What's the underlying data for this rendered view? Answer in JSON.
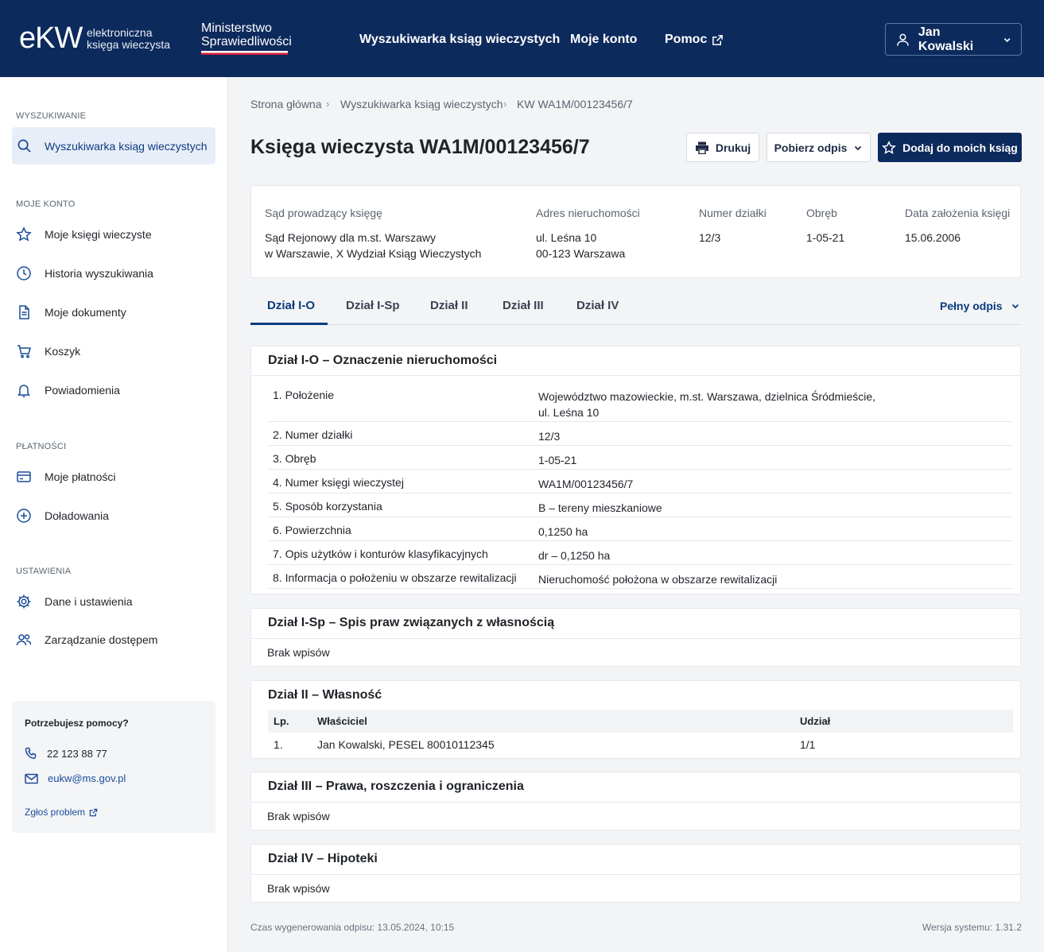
{
  "header": {
    "logo_main": "eKW",
    "logo_sub_1": "elektroniczna",
    "logo_sub_2": "księga wieczysta",
    "ministry_1": "Ministerstwo",
    "ministry_2": "Sprawiedliwości",
    "nav": [
      "Wyszukiwarka ksiąg wieczystych",
      "Moje konto",
      "Pomoc"
    ],
    "user": "Jan Kowalski"
  },
  "sidebar": {
    "sections": {
      "search": "WYSZUKIWANIE",
      "account": "MOJE KONTO",
      "payments": "PŁATNOŚCI",
      "settings": "USTAWIENIA"
    },
    "items": [
      {
        "label": "Wyszukiwarka ksiąg wieczystych",
        "icon": "search-icon"
      },
      {
        "label": "Moje księgi wieczyste",
        "icon": "star-icon"
      },
      {
        "label": "Historia wyszukiwania",
        "icon": "clock-icon"
      },
      {
        "label": "Moje dokumenty",
        "icon": "document-icon"
      },
      {
        "label": "Koszyk",
        "icon": "cart-icon"
      },
      {
        "label": "Powiadomienia",
        "icon": "bell-icon"
      },
      {
        "label": "Moje płatności",
        "icon": "card-icon"
      },
      {
        "label": "Doładowania",
        "icon": "plus-circle-icon"
      },
      {
        "label": "Dane i ustawienia",
        "icon": "gear-icon"
      },
      {
        "label": "Zarządzanie dostępem",
        "icon": "users-icon"
      }
    ],
    "help": {
      "title": "Potrzebujesz pomocy?",
      "phone": "22 123 88 77",
      "email": "eukw@ms.gov.pl",
      "report": "Zgłoś problem"
    }
  },
  "breadcrumb": [
    "Strona główna",
    "Wyszukiwarka ksiąg wieczystych",
    "KW WA1M/00123456/7"
  ],
  "title": "Księga wieczysta WA1M/00123456/7",
  "actions": {
    "print": "Drukuj",
    "download": "Pobierz odpis",
    "add": "Dodaj do moich ksiąg"
  },
  "info": {
    "court_label": "Sąd prowadzący księgę",
    "court_1": "Sąd Rejonowy dla m.st. Warszawy",
    "court_2": "w Warszawie, X Wydział Ksiąg Wieczystych",
    "address_label": "Adres nieruchomości",
    "address_1": "ul. Leśna 10",
    "address_2": "00-123 Warszawa",
    "plot_label": "Numer działki",
    "plot": "12/3",
    "precinct_label": "Obręb",
    "precinct": "1-05-21",
    "date_label": "Data założenia księgi",
    "date": "15.06.2006"
  },
  "tabs": [
    "Dział I-O",
    "Dział I-Sp",
    "Dział II",
    "Dział III",
    "Dział IV"
  ],
  "full_copy": "Pełny odpis",
  "section_io": {
    "title": "Dział I-O – Oznaczenie nieruchomości",
    "rows": [
      {
        "k": "1. Położenie",
        "v": "Województwo mazowieckie, m.st. Warszawa, dzielnica Śródmieście, ul. Leśna 10"
      },
      {
        "k": "2. Numer działki",
        "v": "12/3"
      },
      {
        "k": "3. Obręb",
        "v": "1-05-21"
      },
      {
        "k": "4. Numer księgi wieczystej",
        "v": "WA1M/00123456/7"
      },
      {
        "k": "5. Sposób korzystania",
        "v": "B – tereny mieszkaniowe"
      },
      {
        "k": "6. Powierzchnia",
        "v": "0,1250 ha"
      },
      {
        "k": "7. Opis użytków i konturów klasyfikacyjnych",
        "v": "dr – 0,1250 ha"
      },
      {
        "k": "8. Informacja o położeniu w obszarze rewitalizacji",
        "v": "Nieruchomość położona w obszarze rewitalizacji"
      }
    ]
  },
  "section_isp": {
    "title": "Dział I-Sp – Spis praw związanych z własnością",
    "empty": "Brak wpisów"
  },
  "section_ii": {
    "title": "Dział II – Własność",
    "headers": [
      "Lp.",
      "Właściciel",
      "Udział"
    ],
    "row": [
      "1.",
      "Jan Kowalski, PESEL 80010112345",
      "1/1"
    ]
  },
  "section_iii": {
    "title": "Dział III – Prawa, roszczenia i ograniczenia",
    "empty": "Brak wpisów"
  },
  "section_iv": {
    "title": "Dział IV – Hipoteki",
    "empty": "Brak wpisów"
  },
  "footer": {
    "generated": "Czas wygenerowania odpisu: 13.05.2024, 10:15",
    "version": "Wersja systemu: 1.31.2"
  },
  "colors": {
    "brand": "#0d2a5c",
    "accent": "#0d3a80",
    "flag_red": "#d4213d"
  }
}
